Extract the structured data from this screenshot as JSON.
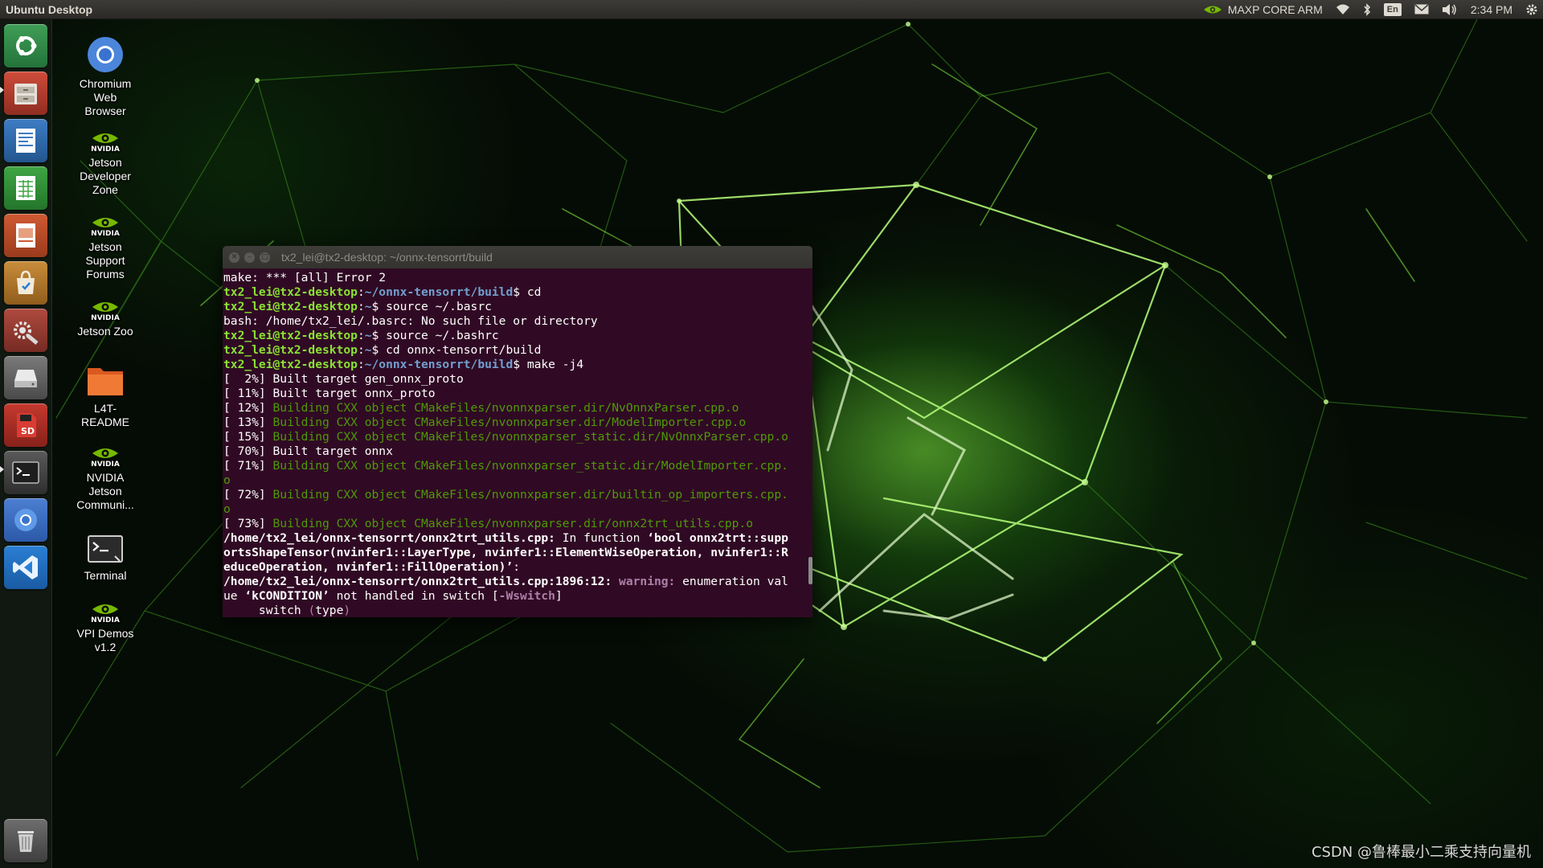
{
  "panel": {
    "title": "Ubuntu Desktop",
    "power_mode": "MAXP CORE ARM",
    "keyboard_layout": "En",
    "clock": "2:34 PM",
    "icons": [
      "nvidia-icon",
      "wifi-icon",
      "bluetooth-icon",
      "keyboard-icon",
      "mail-icon",
      "volume-icon",
      "gear-icon"
    ]
  },
  "launcher": {
    "items": [
      {
        "name": "ubuntu-home",
        "icon": "ubuntu-logo-icon"
      },
      {
        "name": "files",
        "icon": "file-cabinet-icon"
      },
      {
        "name": "libreoffice-writer",
        "icon": "document-icon"
      },
      {
        "name": "libreoffice-calc",
        "icon": "spreadsheet-icon"
      },
      {
        "name": "libreoffice-impress",
        "icon": "presentation-icon"
      },
      {
        "name": "software-center",
        "icon": "shopping-bag-icon"
      },
      {
        "name": "system-settings",
        "icon": "wrench-icon"
      },
      {
        "name": "drive",
        "icon": "drive-icon"
      },
      {
        "name": "sd-card-writer",
        "icon": "sd-card-icon"
      },
      {
        "name": "terminal",
        "icon": "terminal-icon"
      },
      {
        "name": "chromium",
        "icon": "chromium-icon"
      },
      {
        "name": "vscode",
        "icon": "vscode-icon"
      },
      {
        "name": "trash",
        "icon": "trash-icon"
      }
    ]
  },
  "desktop_icons": [
    {
      "label": "Chromium\nWeb\nBrowser",
      "icon": "chromium-icon"
    },
    {
      "label": "Jetson\nDeveloper\nZone",
      "icon": "nvidia-icon",
      "brand": "NVIDIA"
    },
    {
      "label": "Jetson\nSupport\nForums",
      "icon": "nvidia-icon",
      "brand": "NVIDIA"
    },
    {
      "label": "Jetson Zoo",
      "icon": "nvidia-icon",
      "brand": "NVIDIA"
    },
    {
      "label": "L4T-\nREADME",
      "icon": "folder-icon"
    },
    {
      "label": "NVIDIA\nJetson\nCommuni...",
      "icon": "nvidia-icon",
      "brand": "NVIDIA"
    },
    {
      "label": "Terminal",
      "icon": "terminal-icon"
    },
    {
      "label": "VPI Demos\nv1.2",
      "icon": "nvidia-icon",
      "brand": "NVIDIA"
    }
  ],
  "terminal": {
    "title": "tx2_lei@tx2-desktop: ~/onnx-tensorrt/build",
    "lines": [
      [
        {
          "t": "make: *** [all] Error 2"
        }
      ],
      [
        {
          "t": "tx2_lei@tx2-desktop",
          "c": "prompt-user"
        },
        {
          "t": ":"
        },
        {
          "t": "~/onnx-tensorrt/build",
          "c": "prompt-path"
        },
        {
          "t": "$ cd"
        }
      ],
      [
        {
          "t": "tx2_lei@tx2-desktop",
          "c": "prompt-user"
        },
        {
          "t": ":"
        },
        {
          "t": "~",
          "c": "prompt-path"
        },
        {
          "t": "$ source ~/.basrc"
        }
      ],
      [
        {
          "t": "bash: /home/tx2_lei/.basrc: No such file or directory"
        }
      ],
      [
        {
          "t": "tx2_lei@tx2-desktop",
          "c": "prompt-user"
        },
        {
          "t": ":"
        },
        {
          "t": "~",
          "c": "prompt-path"
        },
        {
          "t": "$ source ~/.bashrc"
        }
      ],
      [
        {
          "t": "tx2_lei@tx2-desktop",
          "c": "prompt-user"
        },
        {
          "t": ":"
        },
        {
          "t": "~",
          "c": "prompt-path"
        },
        {
          "t": "$ cd onnx-tensorrt/build"
        }
      ],
      [
        {
          "t": "tx2_lei@tx2-desktop",
          "c": "prompt-user"
        },
        {
          "t": ":"
        },
        {
          "t": "~/onnx-tensorrt/build",
          "c": "prompt-path"
        },
        {
          "t": "$ make -j4"
        }
      ],
      [
        {
          "t": "[  2%] Built target gen_onnx_proto"
        }
      ],
      [
        {
          "t": "[ 11%] Built target onnx_proto"
        }
      ],
      [
        {
          "t": "[ 12%] "
        },
        {
          "t": "Building CXX object CMakeFiles/nvonnxparser.dir/NvOnnxParser.cpp.o",
          "c": "dim-green"
        }
      ],
      [
        {
          "t": "[ 13%] "
        },
        {
          "t": "Building CXX object CMakeFiles/nvonnxparser.dir/ModelImporter.cpp.o",
          "c": "dim-green"
        }
      ],
      [
        {
          "t": "[ 15%] "
        },
        {
          "t": "Building CXX object CMakeFiles/nvonnxparser_static.dir/NvOnnxParser.cpp.o",
          "c": "dim-green"
        }
      ],
      [
        {
          "t": "[ 70%] Built target onnx"
        }
      ],
      [
        {
          "t": "[ 71%] "
        },
        {
          "t": "Building CXX object CMakeFiles/nvonnxparser_static.dir/ModelImporter.cpp.",
          "c": "dim-green"
        }
      ],
      [
        {
          "t": "o",
          "c": "dim-green"
        }
      ],
      [
        {
          "t": "[ 72%] "
        },
        {
          "t": "Building CXX object CMakeFiles/nvonnxparser.dir/builtin_op_importers.cpp.",
          "c": "dim-green"
        }
      ],
      [
        {
          "t": "o",
          "c": "dim-green"
        }
      ],
      [
        {
          "t": "[ 73%] "
        },
        {
          "t": "Building CXX object CMakeFiles/nvonnxparser.dir/onnx2trt_utils.cpp.o",
          "c": "dim-green"
        }
      ],
      [
        {
          "t": "/home/tx2_lei/onnx-tensorrt/onnx2trt_utils.cpp:",
          "c": "bold"
        },
        {
          "t": " In function "
        },
        {
          "t": "‘bool onnx2trt::supp",
          "c": "bold"
        }
      ],
      [
        {
          "t": "ortsShapeTensor(nvinfer1::LayerType, nvinfer1::ElementWiseOperation, nvinfer1::R",
          "c": "bold"
        }
      ],
      [
        {
          "t": "educeOperation, nvinfer1::FillOperation)’",
          "c": "bold"
        },
        {
          "t": ":"
        }
      ],
      [
        {
          "t": "/home/tx2_lei/onnx-tensorrt/onnx2trt_utils.cpp:1896:12:",
          "c": "bold"
        },
        {
          "t": " "
        },
        {
          "t": "warning:",
          "c": "warn"
        },
        {
          "t": " enumeration val"
        }
      ],
      [
        {
          "t": "ue "
        },
        {
          "t": "‘kCONDITION’",
          "c": "bold"
        },
        {
          "t": " not handled in switch ["
        },
        {
          "t": "-Wswitch",
          "c": "warn"
        },
        {
          "t": "]"
        }
      ],
      [
        {
          "t": "     switch "
        },
        {
          "t": "(",
          "c": "mag"
        },
        {
          "t": "type"
        },
        {
          "t": ")",
          "c": "mag"
        }
      ]
    ]
  },
  "watermark": "CSDN @鲁棒最小二乘支持向量机",
  "colors": {
    "terminal_bg": "#300a24",
    "prompt_user": "#8ae234",
    "prompt_path": "#729fcf",
    "build_step": "#4e9a06",
    "warning": "#ad7fa8",
    "nvidia_green": "#76b900"
  }
}
